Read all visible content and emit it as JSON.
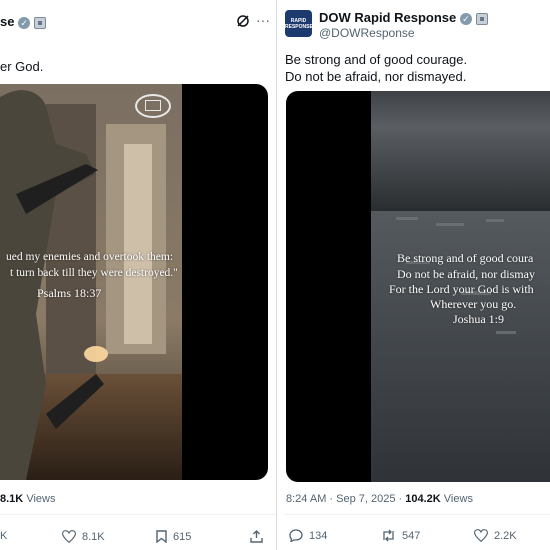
{
  "left_tweet": {
    "author_partial": "se",
    "body_partial": "er God.",
    "image_caption": {
      "line1": "ued my enemies and overtook them:",
      "line2": "t turn back till they were destroyed.\"",
      "reference": "Psalms 18:37"
    },
    "views_count": "8.1K",
    "views_label": "Views",
    "actions": {
      "reply": "K",
      "likes": "8.1K",
      "bookmarks": "615"
    }
  },
  "right_tweet": {
    "author_name": "DOW Rapid Response",
    "handle": "@DOWResponse",
    "avatar_text": {
      "line1": "RAPID",
      "line2": "RESPONSE"
    },
    "body_line1": "Be strong and of good courage.",
    "body_line2": "Do not be afraid, nor dismayed.",
    "image_caption": {
      "line1": "Be strong and of good coura",
      "line2": "Do not be afraid, nor dismay",
      "line3": "For the Lord your God is with",
      "line4": "Wherever you go.",
      "reference": "Joshua 1:9"
    },
    "timestamp": "8:24 AM · Sep 7, 2025 · ",
    "views_count": "104.2K",
    "views_label": "Views",
    "actions": {
      "replies": "134",
      "reposts": "547",
      "likes": "2.2K"
    }
  }
}
